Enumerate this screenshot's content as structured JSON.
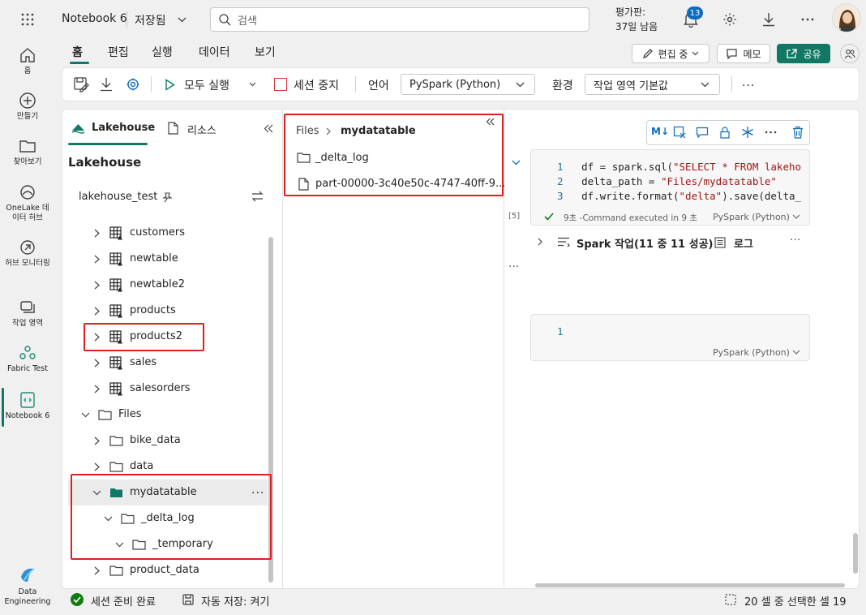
{
  "app": {
    "notebook_title": "Notebook 6",
    "save_state": "저장됨",
    "search_placeholder": "검색",
    "trial_label": "평가판:",
    "trial_days": "37일 남음",
    "notification_count": "13"
  },
  "rail": {
    "items": [
      {
        "label": "홈",
        "icon": "home-icon"
      },
      {
        "label": "만들기",
        "icon": "plus-circle-icon"
      },
      {
        "label": "찾아보기",
        "icon": "folder-icon"
      },
      {
        "label": "OneLake 데이터 허브",
        "icon": "onelake-icon"
      },
      {
        "label": "허브 모니터링",
        "icon": "monitor-icon"
      },
      {
        "label": "작업 영역",
        "icon": "workspaces-icon"
      },
      {
        "label": "Fabric Test",
        "icon": "fabric-test-icon"
      },
      {
        "label": "Notebook 6",
        "icon": "notebook-icon"
      }
    ],
    "footer_label": "Data Engineering"
  },
  "ribbon": {
    "tabs": [
      "홈",
      "편집",
      "실행",
      "데이터",
      "보기"
    ],
    "active_tab": "홈",
    "edit_mode": "편집 중",
    "memo": "메모",
    "share": "공유",
    "run_all": "모두 실행",
    "stop_session": "세션 중지",
    "language_label": "언어",
    "language_value": "PySpark (Python)",
    "environment_label": "환경",
    "environment_value": "작업 영역 기본값",
    "more": "..."
  },
  "explorer": {
    "tab_lakehouse": "Lakehouse",
    "tab_resources": "리소스",
    "heading": "Lakehouse",
    "lakehouse_name": "lakehouse_test",
    "tables": [
      "customers",
      "newtable",
      "newtable2",
      "products",
      "products2",
      "sales",
      "salesorders"
    ],
    "files_label": "Files",
    "folders": [
      "bike_data",
      "data",
      "mydatatable",
      "_delta_log",
      "_temporary",
      "product_data"
    ],
    "row_more": "..."
  },
  "files_panel": {
    "breadcrumb_root": "Files",
    "breadcrumb_current": "mydatatable",
    "items": [
      "_delta_log",
      "part-00000-3c40e50c-4747-40ff-9..."
    ]
  },
  "cell1": {
    "lines": [
      {
        "n": "1",
        "pre": "df = spark.sql(",
        "str": "\"SELECT * FROM lakeho",
        "post": ""
      },
      {
        "n": "2",
        "pre": "delta_path = ",
        "str": "\"Files/mydatatable\"",
        "post": ""
      },
      {
        "n": "3",
        "pre": "df.write.format(",
        "str": "\"delta\"",
        "post": ").save(delta_"
      }
    ],
    "exec_count": "[5]",
    "status": "9초 -Command executed in 9 초",
    "language": "PySpark (Python)",
    "spark_jobs": "Spark 작업(11 중 11 성공)",
    "log": "로그",
    "more": "···"
  },
  "cell2": {
    "line_no": "1",
    "language": "PySpark (Python)"
  },
  "gutter_more": "···",
  "status_bar": {
    "session": "세션 준비 완료",
    "autosave": "자동 저장: 켜기",
    "selection": "20 셀 중 선택한 셀 19"
  },
  "colors": {
    "accent": "#117865",
    "share_bg": "#117865",
    "badge_bg": "#0f6cbd",
    "red_highlight": "#e02020",
    "link": "#0f6cbd"
  }
}
